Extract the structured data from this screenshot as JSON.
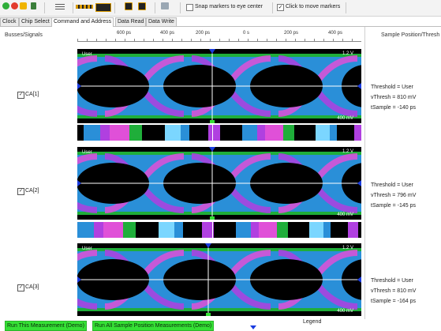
{
  "toolbar": {
    "snap_label": "Snap markers to eye center",
    "click_label": "Click to move markers",
    "snap_checked": false,
    "click_checked": true
  },
  "tabs": [
    {
      "label": "Clock",
      "active": false
    },
    {
      "label": "Chip Select",
      "active": false
    },
    {
      "label": "Command and Address",
      "active": true
    },
    {
      "label": "Data Read",
      "active": false
    },
    {
      "label": "Data Write",
      "active": false
    }
  ],
  "header": {
    "left": "Busses/Signals",
    "right": "Sample Position/Thresh"
  },
  "ruler": [
    "600 ps",
    "400 ps",
    "200 ps",
    "0 s",
    "200 ps",
    "400 ps"
  ],
  "signals": [
    {
      "name": "CA[1]",
      "checked": true,
      "threshold": "Threshold = User",
      "vthresh": "vThresh = 810 mV",
      "tsample": "tSample = -140 ps",
      "user": "User",
      "scale_top": "1.2 V",
      "scale_bot": "400 mV"
    },
    {
      "name": "CA[2]",
      "checked": true,
      "threshold": "Threshold = User",
      "vthresh": "vThresh = 796 mV",
      "tsample": "tSample = -145 ps",
      "user": "User",
      "scale_top": "1.2 V",
      "scale_bot": "400 mV"
    },
    {
      "name": "CA[3]",
      "checked": true,
      "threshold": "Threshold = User",
      "vthresh": "vThresh = 810 mV",
      "tsample": "tSample = -164 ps",
      "user": "User",
      "scale_top": "1.2 V",
      "scale_bot": "400 mV"
    }
  ],
  "buttons": {
    "run_this": "Run This Measurement (Demo)",
    "run_all": "Run All Sample Position Measurements (Demo)"
  },
  "legend_label": "Legend",
  "colors": {
    "accent_green": "#35e035",
    "marker_blue": "#1a3ce0"
  }
}
